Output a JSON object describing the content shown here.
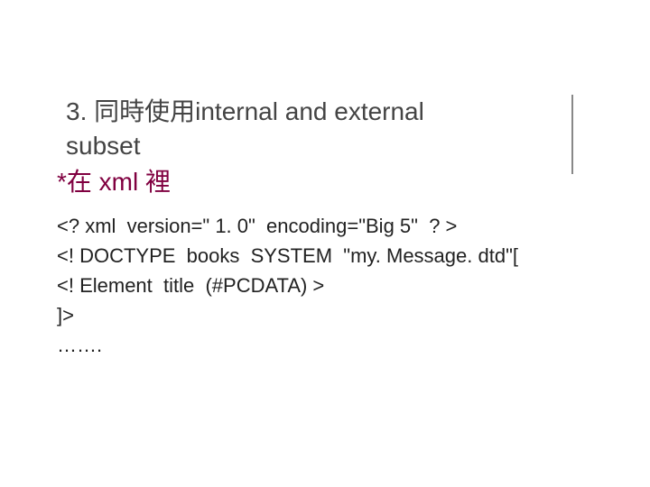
{
  "heading": {
    "line1": "3. 同時使用internal and external",
    "line2": "subset"
  },
  "subtitle": "*在 xml 裡",
  "code": {
    "l1": "<? xml  version=\" 1. 0\"  encoding=\"Big 5\"  ? >",
    "l2": "<! DOCTYPE  books  SYSTEM  \"my. Message. dtd\"[",
    "l3": "<! Element  title  (#PCDATA) >",
    "l4": "]>",
    "l5": "……."
  }
}
